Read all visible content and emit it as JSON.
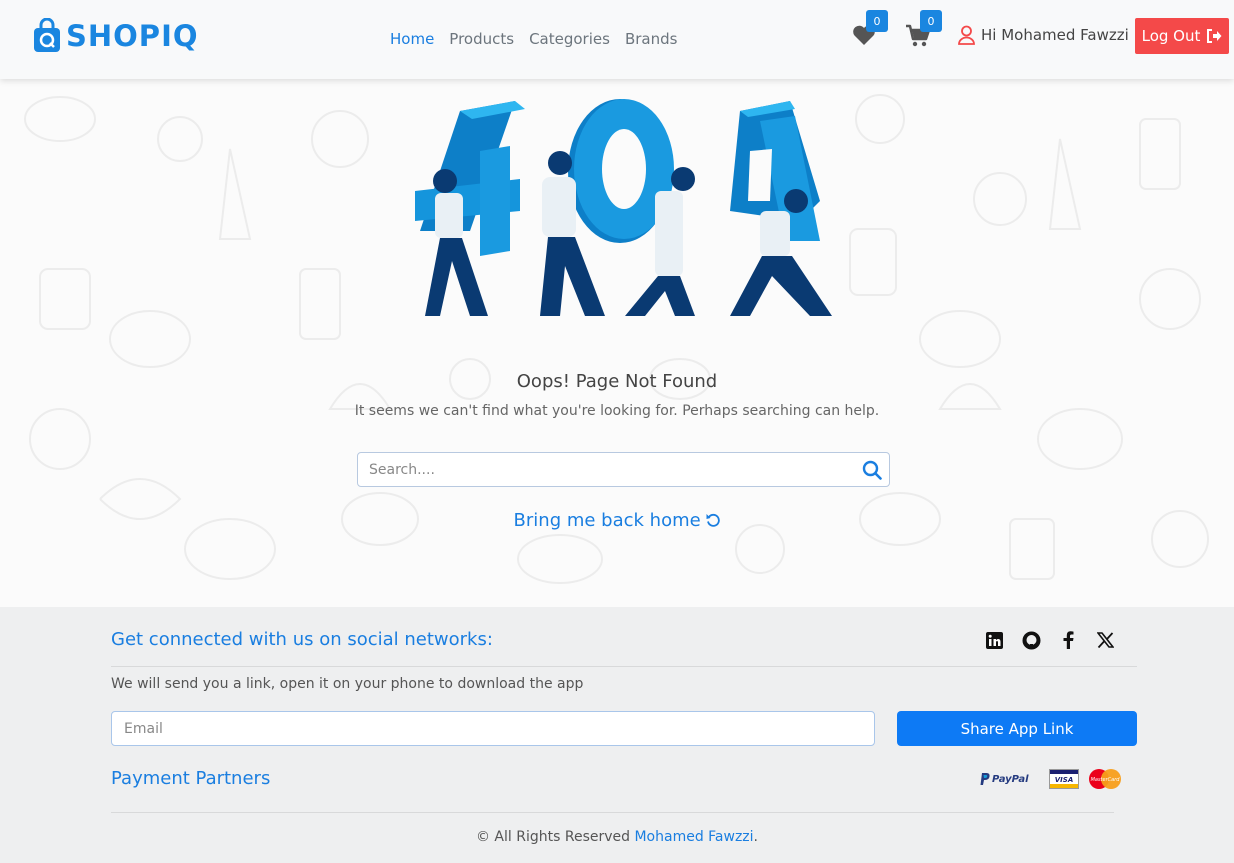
{
  "header": {
    "logo_text": "SHOPIQ",
    "nav": [
      {
        "label": "Home",
        "active": true
      },
      {
        "label": "Products",
        "active": false
      },
      {
        "label": "Categories",
        "active": false
      },
      {
        "label": "Brands",
        "active": false
      }
    ],
    "wishlist_count": "0",
    "cart_count": "0",
    "greeting": "Hi Mohamed Fawzzi",
    "logout_label": "Log Out"
  },
  "main": {
    "hero_digits": [
      "4",
      "0",
      "4"
    ],
    "title": "Oops! Page Not Found",
    "subtitle": "It seems we can't find what you're looking for. Perhaps searching can help.",
    "search_placeholder": "Search....",
    "home_link": "Bring me back home"
  },
  "footer": {
    "social_heading": "Get connected with us on social networks:",
    "socials": [
      "linkedin-icon",
      "github-icon",
      "facebook-icon",
      "x-icon"
    ],
    "description": "We will send you a link, open it on your phone to download the app",
    "email_placeholder": "Email",
    "share_label": "Share App Link",
    "payment_heading": "Payment Partners",
    "payment_logos": [
      "PayPal",
      "VISA",
      "MasterCard"
    ],
    "copyright_prefix": "© All Rights Reserved ",
    "copyright_name": "Mohamed Fawzzi",
    "copyright_suffix": "."
  },
  "colors": {
    "brand": "#1a86e0",
    "logout": "#f44949",
    "share": "#0d7af5",
    "footer_bg": "#eeeff0"
  }
}
